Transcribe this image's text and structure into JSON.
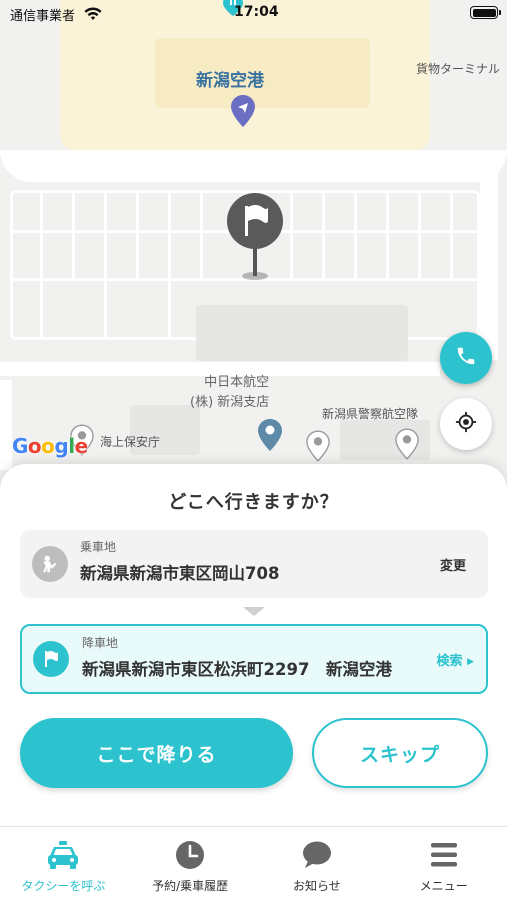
{
  "status_bar": {
    "carrier": "通信事業者",
    "time": "17:04"
  },
  "map": {
    "airport_name": "新潟空港",
    "cargo_terminal": "貨物ターミナル",
    "jal_line1": "中日本航空",
    "jal_line2": "(株) 新潟支店",
    "police": "新潟県警察航空隊",
    "coast_guard": "海上保安庁",
    "google_logo": "Google"
  },
  "sheet": {
    "title": "どこへ行きますか？",
    "pickup": {
      "caption": "乗車地",
      "address": "新潟県新潟市東区岡山708",
      "action": "変更"
    },
    "dropoff": {
      "caption": "降車地",
      "address": "新潟県新潟市東区松浜町2297　新潟空港",
      "action": "検索"
    },
    "primary_button": "ここで降りる",
    "secondary_button": "スキップ"
  },
  "tabs": [
    {
      "label": "タクシーを呼ぶ",
      "icon": "taxi-icon",
      "active": true
    },
    {
      "label": "予約/乗車履歴",
      "icon": "clock-icon",
      "active": false
    },
    {
      "label": "お知らせ",
      "icon": "chat-bubble-icon",
      "active": false
    },
    {
      "label": "メニュー",
      "icon": "menu-icon",
      "active": false
    }
  ],
  "colors": {
    "accent": "#2cc3cf",
    "text": "#333333",
    "inactive_icon": "#666666"
  }
}
